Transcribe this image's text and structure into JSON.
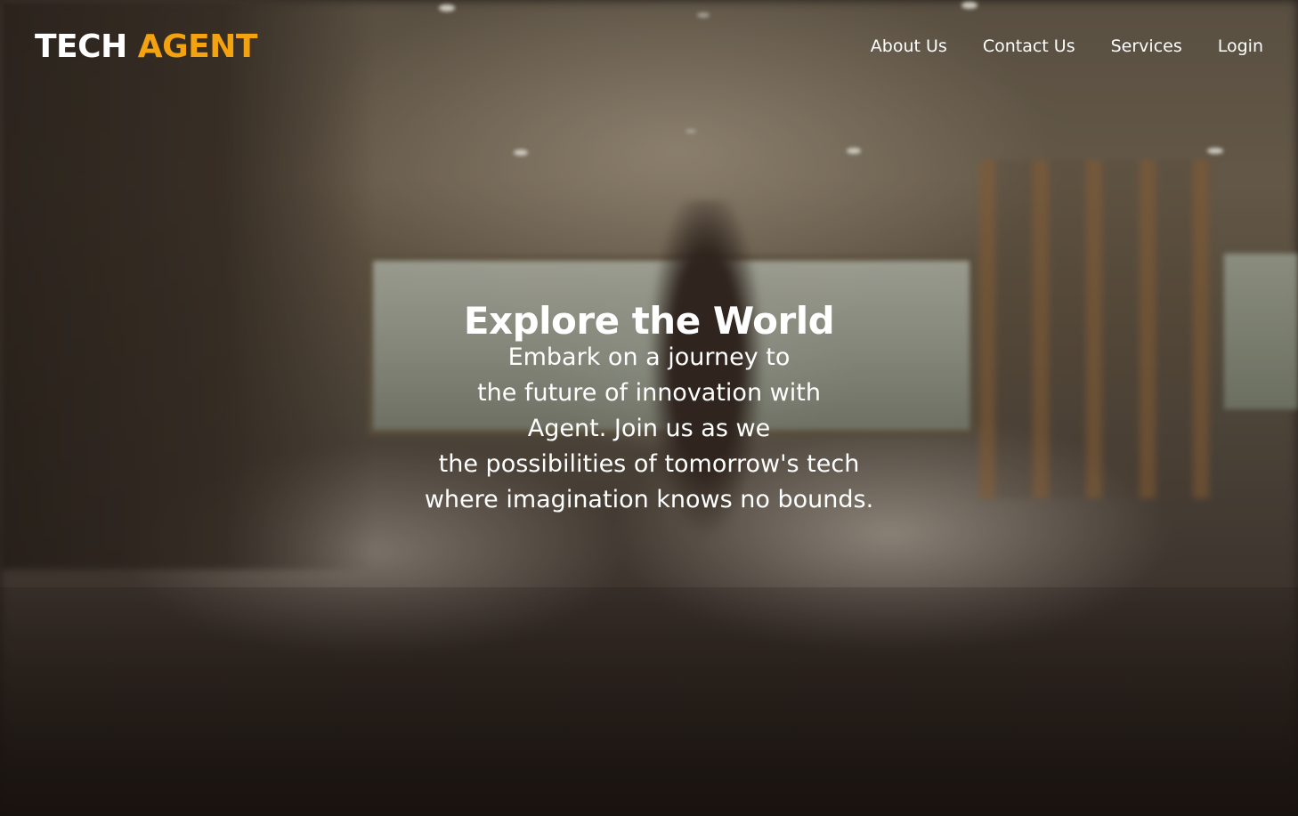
{
  "brand": {
    "word1": "TECH",
    "word2": "AGENT",
    "accent_color": "#f2a30f"
  },
  "nav": {
    "items": [
      {
        "label": "About Us"
      },
      {
        "label": "Contact Us"
      },
      {
        "label": "Services"
      },
      {
        "label": "Login"
      }
    ]
  },
  "hero": {
    "title": "Explore the World",
    "lines": [
      "Embark on a journey to",
      "the future of innovation with",
      "Agent. Join us as we",
      "the possibilities of tomorrow's tech",
      "where imagination knows no bounds."
    ]
  }
}
